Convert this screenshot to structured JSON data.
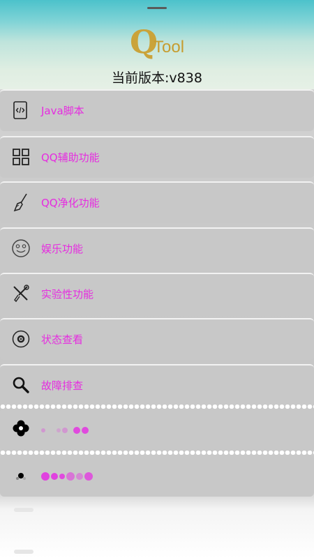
{
  "header": {
    "logo_q": "Q",
    "logo_tool": "Tool",
    "version_text": "当前版本:v838"
  },
  "menu": {
    "items": [
      {
        "label": "Java脚本",
        "icon": "java-script-icon"
      },
      {
        "label": "QQ辅助功能",
        "icon": "grid-icon"
      },
      {
        "label": "QQ净化功能",
        "icon": "broom-icon"
      },
      {
        "label": "娱乐功能",
        "icon": "smiley-icon"
      },
      {
        "label": "实验性功能",
        "icon": "tools-icon"
      },
      {
        "label": "状态查看",
        "icon": "gear-status-icon"
      },
      {
        "label": "故障排查",
        "icon": "magnifier-icon"
      }
    ]
  },
  "colors": {
    "label": "#e62ce0",
    "item_bg": "#c8c8c8",
    "header_top": "#4cc2cb"
  }
}
